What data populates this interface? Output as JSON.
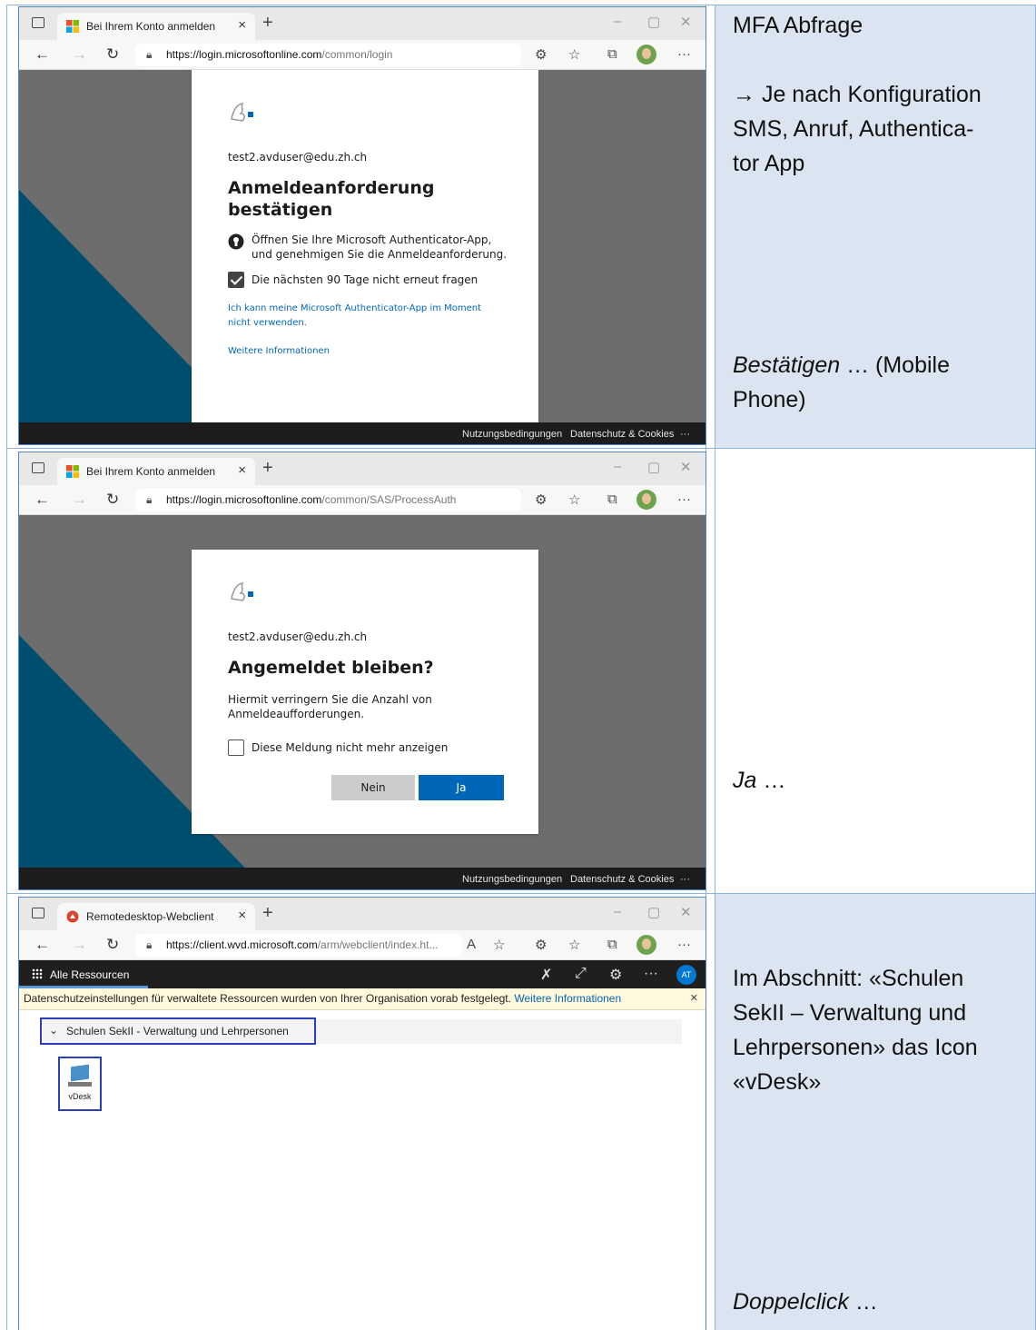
{
  "rows": [
    {
      "browser": {
        "tab_title": "Bei Ihrem Konto anmelden",
        "url_host": "https://login.microsoftonline.com",
        "url_path": "/common/login"
      },
      "card": {
        "user": "test2.avduser@edu.zh.ch",
        "title_line1": "Anmeldeanforderung",
        "title_line2": "bestätigen",
        "instr_line1": "Öffnen Sie Ihre Microsoft Authenticator-App,",
        "instr_line2": "und genehmigen Sie die Anmeldeanforderung.",
        "checkbox_label": "Die nächsten 90 Tage nicht erneut fragen",
        "checkbox_checked": true,
        "link1_line1": "Ich kann meine Microsoft Authenticator-App im Moment",
        "link1_line2": "nicht verwenden.",
        "link2": "Weitere Informationen"
      },
      "footer": {
        "terms": "Nutzungsbedingungen",
        "privacy": "Datenschutz & Cookies",
        "more": "···"
      },
      "note": {
        "line1": "MFA Abfrage",
        "line2": "→ Je nach Konfiguration",
        "line3": "SMS, Anruf, Authentica-",
        "line4": "tor App",
        "emph": "Bestätigen",
        "rest1": " … (Mobile",
        "rest2": "Phone)"
      }
    },
    {
      "browser": {
        "tab_title": "Bei Ihrem Konto anmelden",
        "url_host": "https://login.microsoftonline.com",
        "url_path": "/common/SAS/ProcessAuth"
      },
      "card": {
        "user": "test2.avduser@edu.zh.ch",
        "title": "Angemeldet bleiben?",
        "text_line1": "Hiermit verringern Sie die Anzahl von",
        "text_line2": "Anmeldeaufforderungen.",
        "checkbox_label": "Diese Meldung nicht mehr anzeigen",
        "checkbox_checked": false,
        "btn_no": "Nein",
        "btn_yes": "Ja"
      },
      "footer": {
        "terms": "Nutzungsbedingungen",
        "privacy": "Datenschutz & Cookies",
        "more": "···"
      },
      "note": {
        "emph": "Ja",
        "rest": " …"
      }
    },
    {
      "browser": {
        "tab_title": "Remotedesktop-Webclient",
        "url_host": "https://client.wvd.microsoft.com",
        "url_path": "/arm/webclient/index.ht..."
      },
      "wvd": {
        "tab_label": "Alle Ressourcen",
        "avatar_initials": "AT",
        "privacy_text": "Datenschutzeinstellungen für verwaltete Ressourcen wurden von Ihrer Organisation vorab festgelegt.",
        "privacy_link": "Weitere Informationen",
        "group_label": "Schulen SekII - Verwaltung und Lehrpersonen",
        "app_name": "vDesk"
      },
      "note": {
        "line1": "Im Abschnitt: «Schulen",
        "line2": "SekII – Verwaltung und",
        "line3": "Lehrpersonen» das Icon",
        "line4": "«vDesk»",
        "emph": "Doppelclick",
        "rest": " …"
      }
    }
  ],
  "colors": {
    "accent_blue": "#0067b8",
    "button_primary": "#0067b8",
    "highlight_box": "#2b3fb8",
    "note_bg": "#dbe5f1",
    "page_bg_gray": "#6d6d6d",
    "page_bg_teal": "#004e6e"
  },
  "icons": [
    "sidebar-toggle-icon",
    "microsoft-logo-icon",
    "close-icon",
    "plus-icon",
    "back-icon",
    "forward-icon",
    "refresh-icon",
    "lock-icon",
    "extensions-icon",
    "favorites-icon",
    "collections-icon",
    "profile-avatar-icon",
    "more-icon",
    "authenticator-icon",
    "checkbox-icon",
    "app-grid-icon",
    "pin-icon",
    "expand-icon",
    "gear-icon",
    "chevron-down-icon",
    "monitor-icon"
  ]
}
